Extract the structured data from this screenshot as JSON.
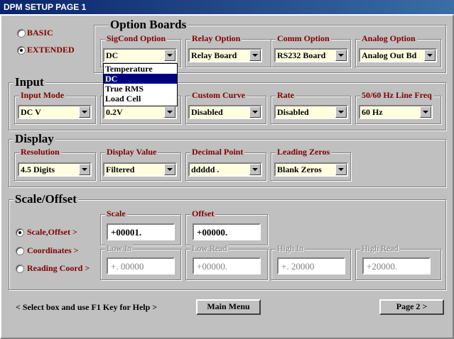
{
  "window": {
    "title": "DPM SETUP  PAGE  1"
  },
  "mode": {
    "options": [
      {
        "label": "BASIC",
        "selected": false
      },
      {
        "label": "EXTENDED",
        "selected": true
      }
    ]
  },
  "option_boards": {
    "title": "Option Boards",
    "sigcond": {
      "label": "SigCond Option",
      "value": "DC",
      "list": [
        "Temperature",
        "DC",
        "True RMS",
        "Load Cell"
      ],
      "list_selected": "DC"
    },
    "relay": {
      "label": "Relay Option",
      "value": "Relay Board"
    },
    "comm": {
      "label": "Comm Option",
      "value": "RS232 Board"
    },
    "analog": {
      "label": "Analog Option",
      "value": "Analog Out Bd"
    }
  },
  "input": {
    "title": "Input",
    "input_mode": {
      "label": "Input Mode",
      "value": "DC V"
    },
    "range": {
      "value": "0.2V"
    },
    "custom_curve": {
      "label": "Custom Curve",
      "value": "Disabled"
    },
    "rate": {
      "label": "Rate",
      "value": "Disabled"
    },
    "line_freq": {
      "label": "50/60 Hz Line Freq",
      "value": "60 Hz"
    }
  },
  "display": {
    "title": "Display",
    "resolution": {
      "label": "Resolution",
      "value": "4.5 Digits"
    },
    "display_value": {
      "label": "Display Value",
      "value": "Filtered"
    },
    "decimal_point": {
      "label": "Decimal Point",
      "value": "ddddd ."
    },
    "leading_zeros": {
      "label": "Leading Zeros",
      "value": "Blank Zeros"
    }
  },
  "scale_offset": {
    "title": "Scale/Offset",
    "radios": [
      {
        "label": "Scale,Offset  >",
        "selected": true
      },
      {
        "label": "Coordinates  >",
        "selected": false
      },
      {
        "label": "Reading Coord >",
        "selected": false
      }
    ],
    "scale": {
      "label": "Scale",
      "value": "+00001."
    },
    "offset": {
      "label": "Offset",
      "value": "+00000."
    },
    "low_in": {
      "label": "Low In",
      "value": "+. 00000"
    },
    "low_read": {
      "label": "Low Read",
      "value": "+00000."
    },
    "high_in": {
      "label": "High In",
      "value": "+. 20000"
    },
    "high_read": {
      "label": "High Read",
      "value": "+20000."
    }
  },
  "footer": {
    "help_text": "<  Select box and use F1 Key for Help  >",
    "main_menu": "Main Menu",
    "page2": "Page 2   >"
  }
}
